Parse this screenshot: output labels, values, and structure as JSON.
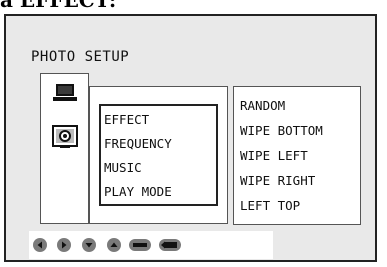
{
  "caption_fragment": "a EFFECT:",
  "screen": {
    "section_title": "PHOTO SETUP",
    "menu_items": [
      "EFFECT",
      "FREQUENCY",
      "MUSIC",
      "PLAY MODE"
    ],
    "options": [
      "RANDOM",
      "WIPE BOTTOM",
      "WIPE LEFT",
      "WIPE RIGHT",
      "LEFT TOP"
    ],
    "icons": [
      "monitor-icon",
      "settings-box-icon"
    ],
    "nav_buttons": [
      "left-arrow-icon",
      "right-arrow-icon",
      "down-arrow-icon",
      "up-arrow-icon",
      "enter-icon",
      "return-icon"
    ]
  },
  "colors": {
    "screen_bg": "#e9e9e9",
    "panel_bg": "#ffffff",
    "border": "#222222",
    "nav_icon": "#7a7a7a"
  }
}
